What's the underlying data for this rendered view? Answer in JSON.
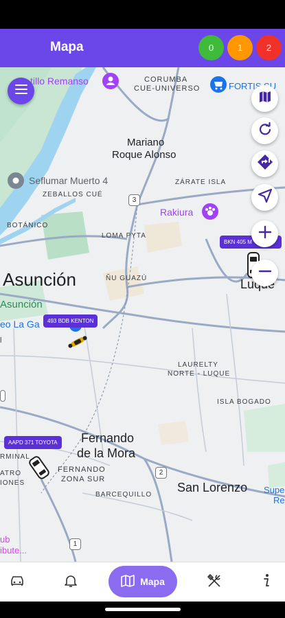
{
  "header": {
    "title": "Mapa",
    "badges": [
      {
        "count": "0",
        "color": "#3fba3a"
      },
      {
        "count": "1",
        "color": "#ff9800"
      },
      {
        "count": "2",
        "color": "#f0312a"
      }
    ]
  },
  "map": {
    "labels": {
      "castillo": "tillo Remanso",
      "corumba": "CORUMBA",
      "cue_universo": "CUE-UNIVERSO",
      "fortis": "FORTIS SU",
      "mariano": "Mariano",
      "roque_alonso": "Roque Alonso",
      "seflumar": "Seflumar Muerto 4",
      "zeballos": "ZEBALLOS CUÉ",
      "zarate": "ZÁRATE ISLA",
      "rakiura": "Rakiura",
      "botanico": "BOTÁNICO",
      "loma_pyta": "LOMA PYTA",
      "asuncion_big": "Asunción",
      "nu_guazu": "ÑU GUAZÚ",
      "luque": "Luque",
      "asuncion_green": "Asunción",
      "eo_la_ga": "eo La Ga",
      "laurelty": "LAURELTY",
      "norte_luque": "NORTE - LUQUE",
      "isla_bogado": "ISLA BOGADO",
      "fernando": "Fernando",
      "de_la_mora": "de la Mora",
      "rminal": "RMINAL",
      "fernando_zona": "FERNANDO",
      "zona_sur": "ZONA SUR",
      "atro": "ATRO",
      "iones": "IONES",
      "barcequillo": "BARCEQUILLO",
      "san_lorenzo": "San Lorenzo",
      "supe": "Supe",
      "re": "Re",
      "ub": "ub",
      "ibute": "ibute...",
      "l": "l"
    },
    "route_shields": {
      "r3": "3",
      "r2": "2",
      "r1": "1"
    },
    "vehicles": [
      {
        "tag": "493 BDB KENTON",
        "icon": "motorcycle-icon"
      },
      {
        "tag": "BKN 405 M",
        "icon": "car-icon"
      },
      {
        "tag": "AAPD 371 TOYOTA",
        "icon": "car-icon"
      }
    ]
  },
  "controls": [
    "map-layers-icon",
    "refresh-icon",
    "directions-icon",
    "navigation-arrow-icon",
    "zoom-in-icon",
    "zoom-out-icon"
  ],
  "nav": {
    "items": [
      {
        "icon": "car-icon"
      },
      {
        "icon": "bell-icon"
      },
      {
        "icon": "map-icon",
        "label": "Mapa"
      },
      {
        "icon": "tools-icon"
      },
      {
        "icon": "info-icon"
      }
    ]
  }
}
